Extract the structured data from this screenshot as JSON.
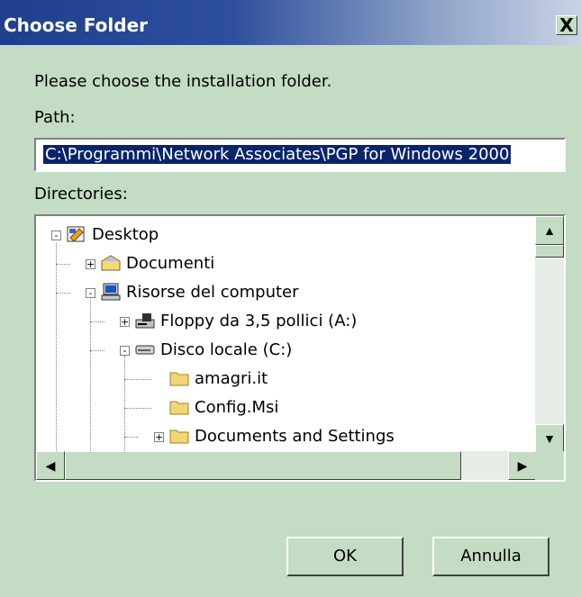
{
  "window": {
    "title": "Choose Folder",
    "close_label": "X"
  },
  "prompt": "Please choose the installation folder.",
  "path": {
    "label": "Path:",
    "value": "C:\\Programmi\\Network Associates\\PGP for Windows 2000"
  },
  "directories": {
    "label": "Directories:",
    "items": [
      {
        "label": "Desktop",
        "icon": "desktop-icon",
        "expander": "-"
      },
      {
        "label": "Documenti",
        "icon": "my-documents-icon",
        "expander": "+"
      },
      {
        "label": "Risorse del computer",
        "icon": "my-computer-icon",
        "expander": "-"
      },
      {
        "label": "Floppy da 3,5 pollici (A:)",
        "icon": "floppy-drive-icon",
        "expander": "+"
      },
      {
        "label": "Disco locale (C:)",
        "icon": "hard-drive-icon",
        "expander": "-"
      },
      {
        "label": "amagri.it",
        "icon": "folder-icon",
        "expander": ""
      },
      {
        "label": "Config.Msi",
        "icon": "folder-icon",
        "expander": ""
      },
      {
        "label": "Documents and Settings",
        "icon": "folder-icon",
        "expander": "+"
      }
    ]
  },
  "buttons": {
    "ok": "OK",
    "cancel": "Annulla"
  }
}
